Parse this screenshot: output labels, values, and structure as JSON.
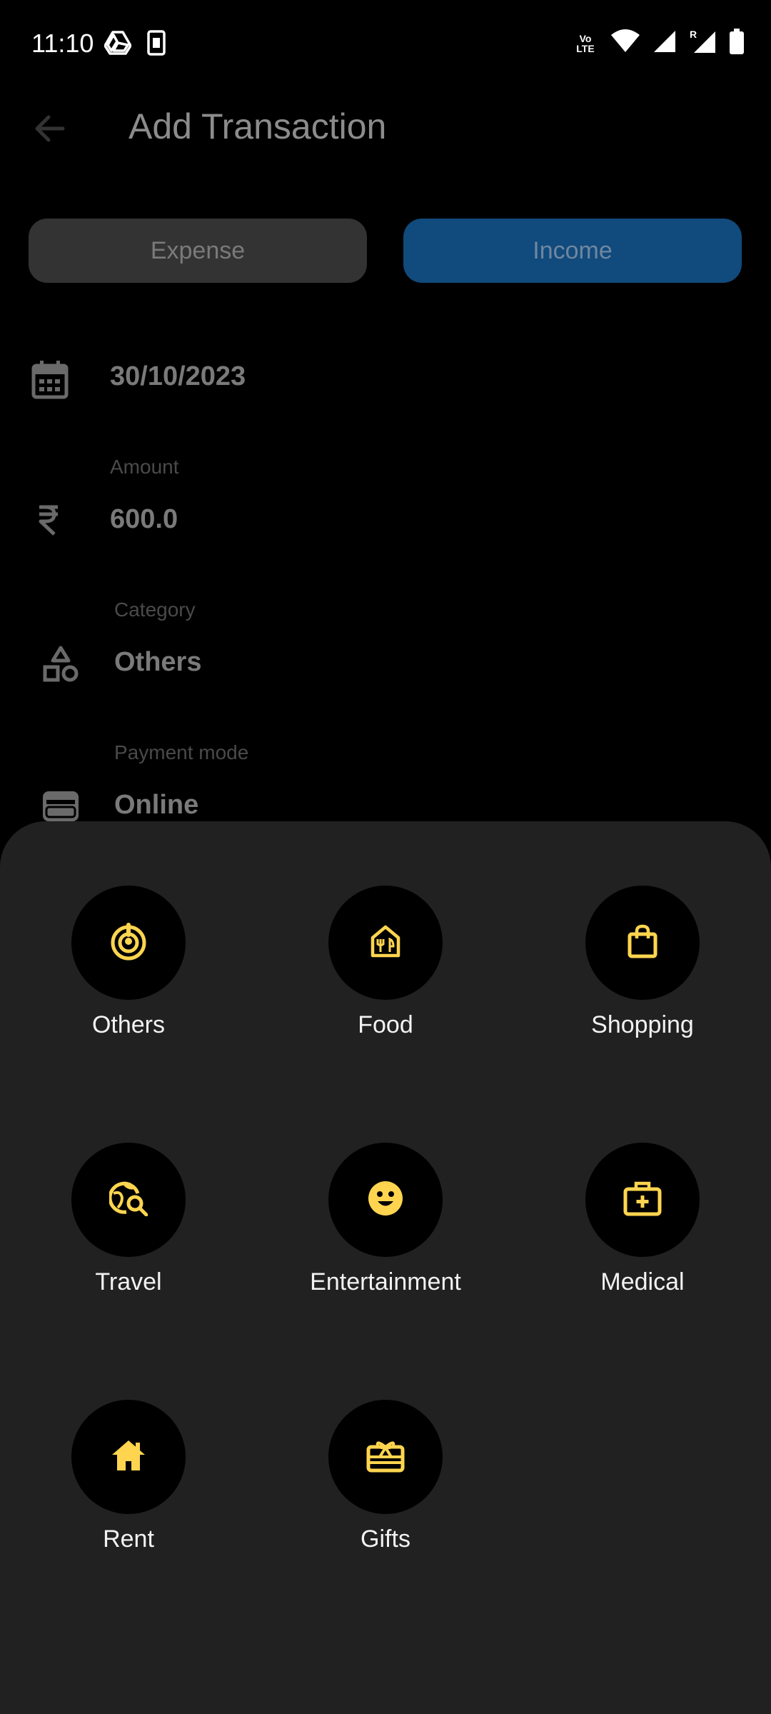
{
  "status_bar": {
    "time": "11:10",
    "icons": [
      "drive-icon",
      "sim-icon",
      "volte-icon",
      "wifi-icon",
      "signal-icon",
      "roaming-signal-icon",
      "battery-icon"
    ]
  },
  "app_bar": {
    "back_icon": "arrow-back-icon",
    "title": "Add Transaction"
  },
  "type_toggle": {
    "expense_label": "Expense",
    "income_label": "Income",
    "selected": "Income"
  },
  "form": {
    "date": {
      "icon": "calendar-icon",
      "value": "30/10/2023"
    },
    "amount": {
      "icon": "rupee-icon",
      "label": "Amount",
      "value": "600.0"
    },
    "category": {
      "icon": "category-icon",
      "label": "Category",
      "value": "Others"
    },
    "payment_mode": {
      "icon": "wallet-icon",
      "label": "Payment mode",
      "value": "Online"
    }
  },
  "category_sheet": {
    "accent_color": "#ffd54f",
    "items": [
      {
        "label": "Others",
        "icon": "target-icon"
      },
      {
        "label": "Food",
        "icon": "restaurant-icon"
      },
      {
        "label": "Shopping",
        "icon": "shopping-bag-icon"
      },
      {
        "label": "Travel",
        "icon": "travel-explore-icon"
      },
      {
        "label": "Entertainment",
        "icon": "smiley-icon"
      },
      {
        "label": "Medical",
        "icon": "medical-kit-icon"
      },
      {
        "label": "Rent",
        "icon": "house-icon"
      },
      {
        "label": "Gifts",
        "icon": "gift-card-icon"
      }
    ]
  }
}
